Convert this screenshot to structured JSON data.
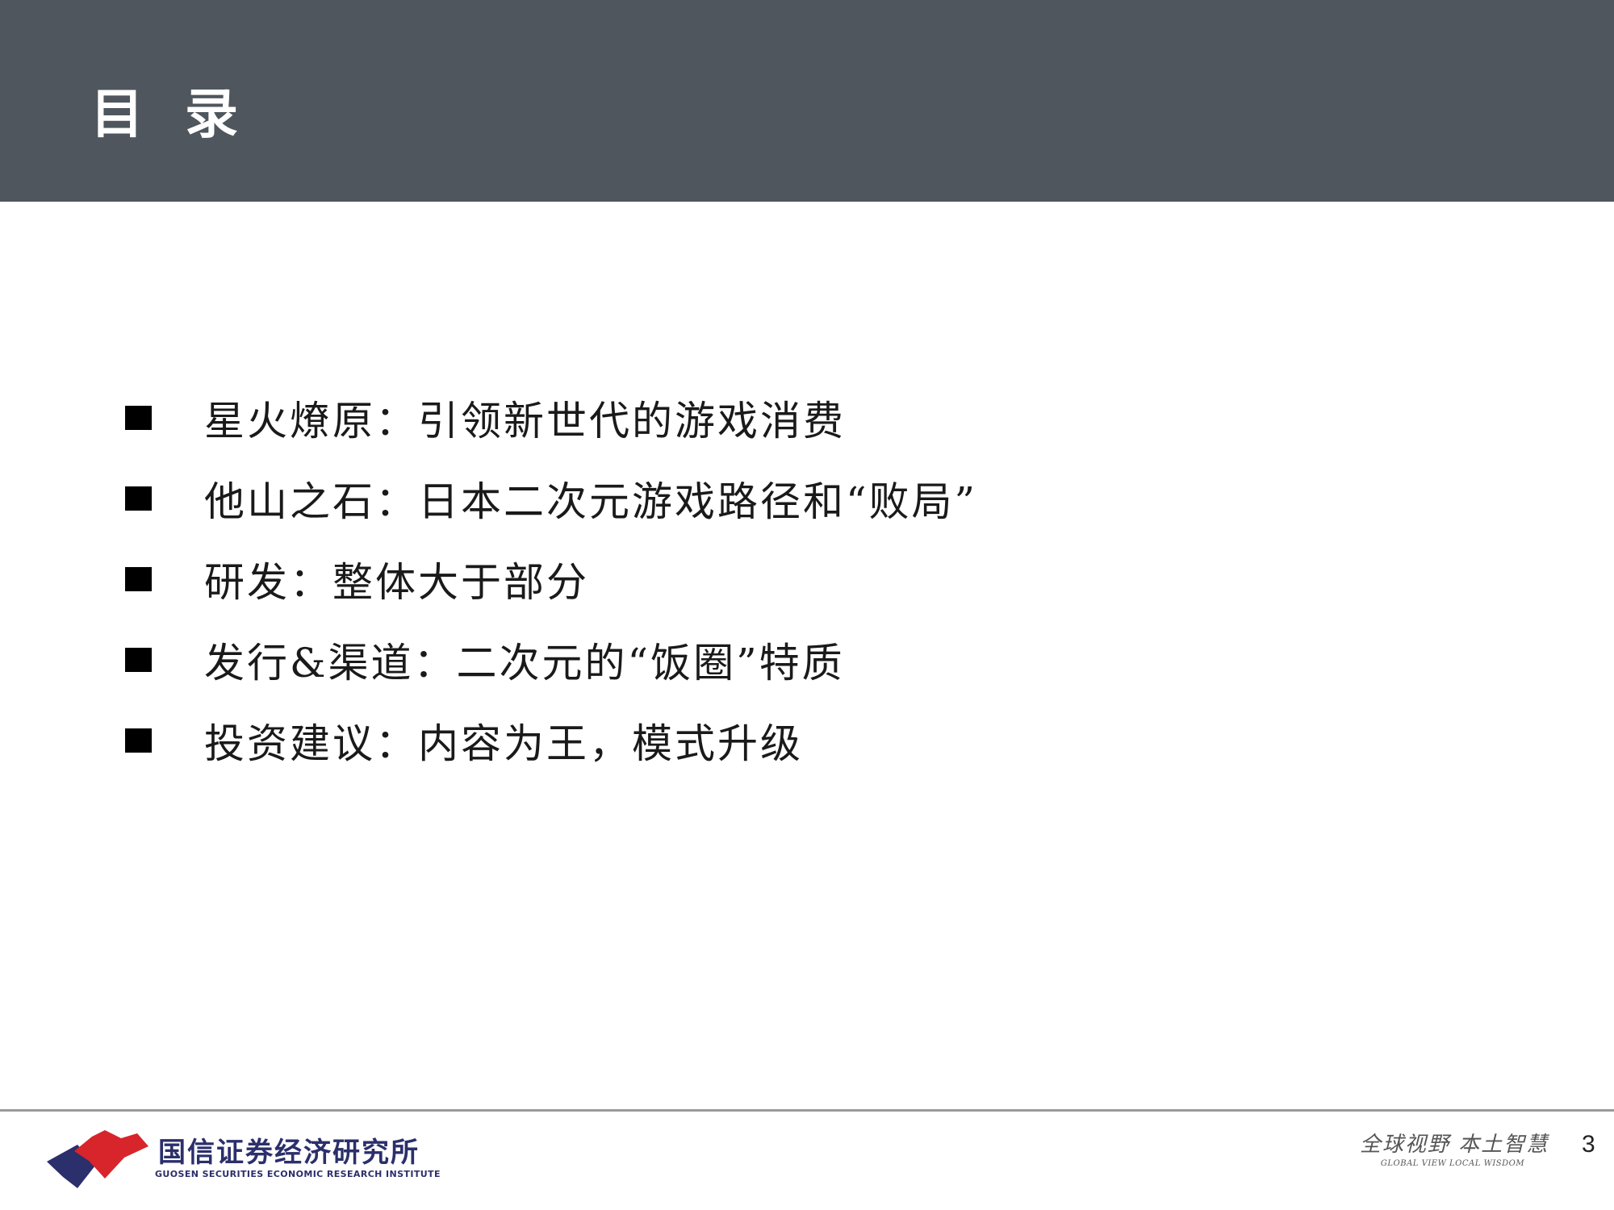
{
  "header": {
    "title": "目 录"
  },
  "toc": {
    "items": [
      {
        "label": "星火燎原：引领新世代的游戏消费"
      },
      {
        "label": "他山之石：日本二次元游戏路径和“败局”"
      },
      {
        "label": "研发：整体大于部分"
      },
      {
        "label": "发行&渠道：二次元的“饭圈”特质"
      },
      {
        "label": "投资建议：内容为王，模式升级"
      }
    ]
  },
  "footer": {
    "logo_cn": "国信证券经济研究所",
    "logo_en": "GUOSEN SECURITIES ECONOMIC RESEARCH INSTITUTE",
    "slogan_cn": "全球视野 本土智慧",
    "slogan_en": "GLOBAL VIEW   LOCAL WISDOM",
    "page_number": "3"
  },
  "colors": {
    "header_bg": "#4f565e",
    "logo_red": "#d7252b",
    "logo_blue": "#2b2f6b"
  }
}
